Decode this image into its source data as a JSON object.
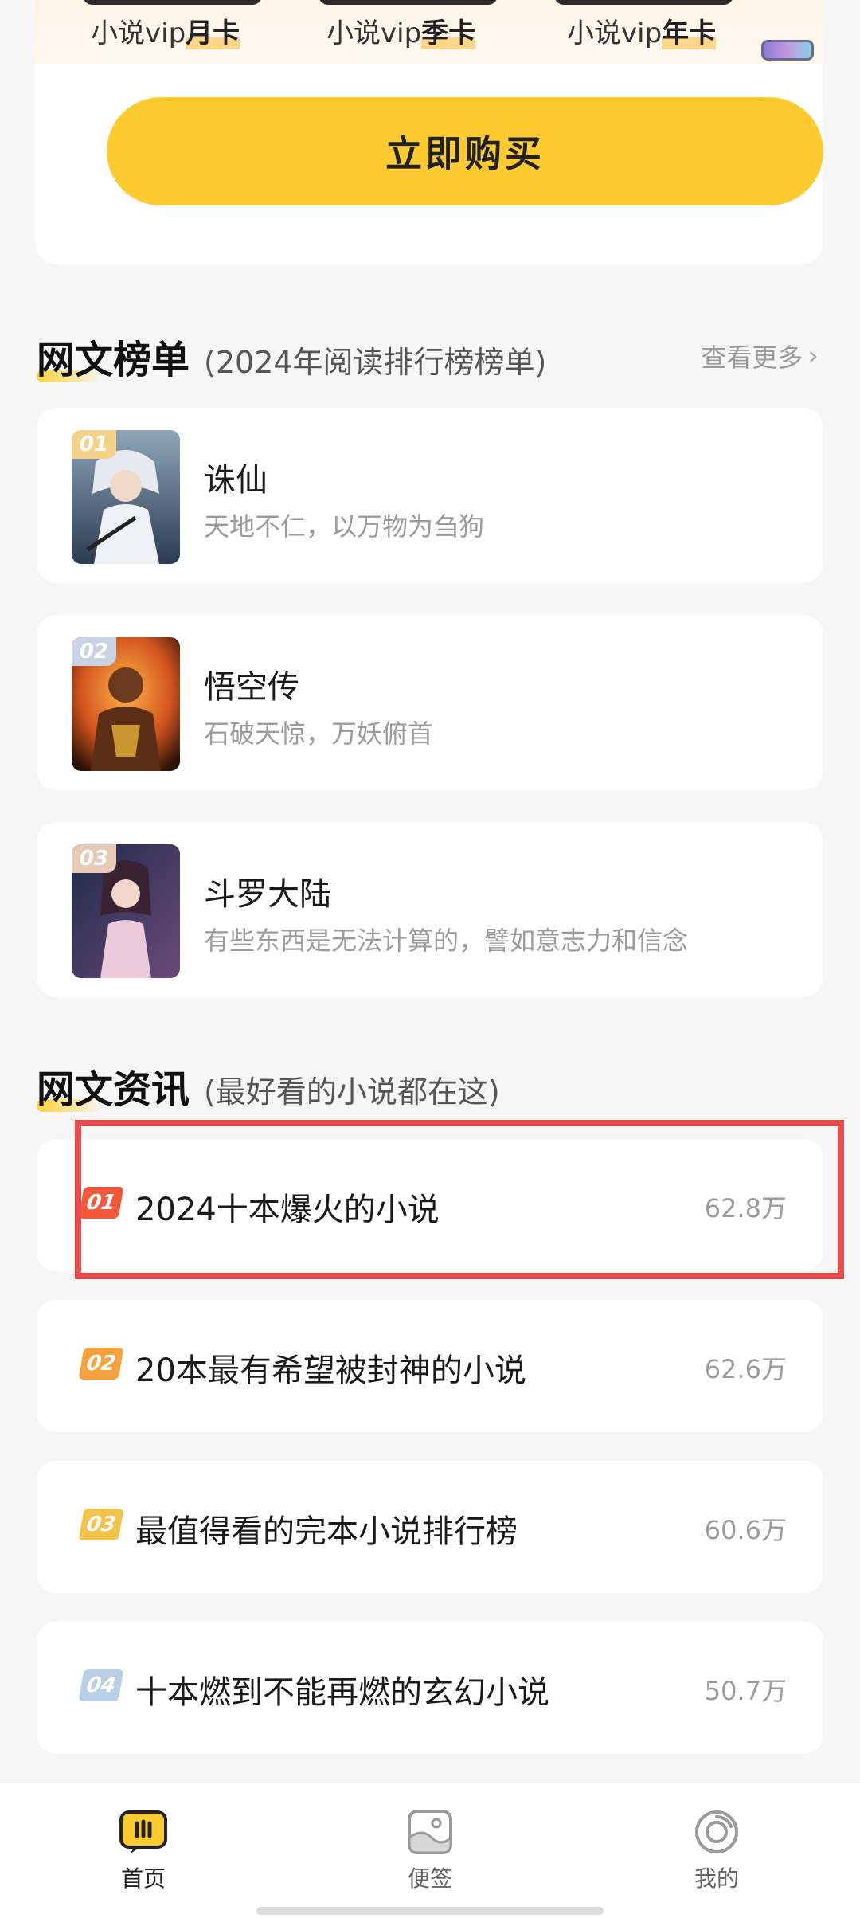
{
  "vip": {
    "options": [
      {
        "prefix": "小说vip",
        "emph": "月卡"
      },
      {
        "prefix": "小说vip",
        "emph": "季卡"
      },
      {
        "prefix": "小说vip",
        "emph": "年卡"
      }
    ],
    "buy_label": "立即购买"
  },
  "ranking": {
    "title": "网文榜单",
    "subtitle": "(2024年阅读排行榜榜单)",
    "see_more": "查看更多",
    "items": [
      {
        "rank": "01",
        "title": "诛仙",
        "desc": "天地不仁，以万物为刍狗",
        "badge_color": "#f5d28a"
      },
      {
        "rank": "02",
        "title": "悟空传",
        "desc": "石破天惊，万妖俯首",
        "badge_color": "#c8d3e3"
      },
      {
        "rank": "03",
        "title": "斗罗大陆",
        "desc": "有些东西是无法计算的，譬如意志力和信念",
        "badge_color": "#e7c9b8"
      }
    ]
  },
  "news": {
    "title": "网文资讯",
    "subtitle": "(最好看的小说都在这)",
    "items": [
      {
        "rank": "01",
        "title": "2024十本爆火的小说",
        "count": "62.8万",
        "color": "#f2583a"
      },
      {
        "rank": "02",
        "title": "20本最有希望被封神的小说",
        "count": "62.6万",
        "color": "#f7a23a"
      },
      {
        "rank": "03",
        "title": "最值得看的完本小说排行榜",
        "count": "60.6万",
        "color": "#f5c34a"
      },
      {
        "rank": "04",
        "title": "十本燃到不能再燃的玄幻小说",
        "count": "50.7万",
        "color": "#b9cfe6"
      }
    ]
  },
  "nav": {
    "items": [
      {
        "label": "首页",
        "icon": "home-icon",
        "active": true
      },
      {
        "label": "便签",
        "icon": "notes-icon",
        "active": false
      },
      {
        "label": "我的",
        "icon": "profile-icon",
        "active": false
      }
    ]
  },
  "colors": {
    "accent": "#fdca30",
    "highlight": "#e84c4c"
  }
}
